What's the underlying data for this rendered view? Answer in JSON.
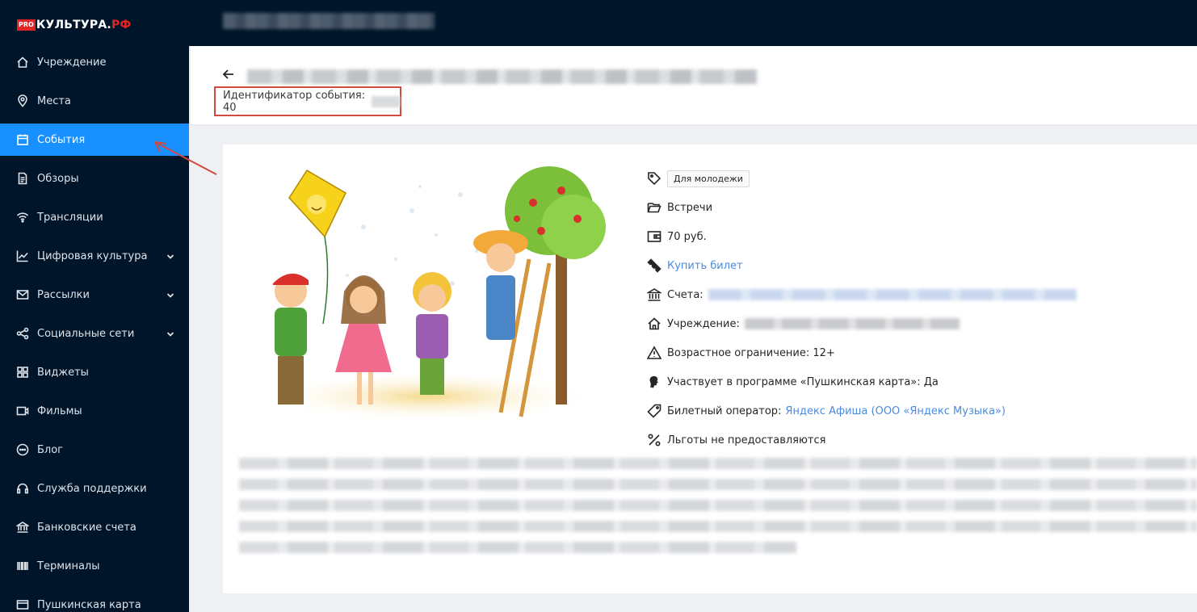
{
  "logo": {
    "pro": "PRO",
    "brand_main": "КУЛЬТУРА.",
    "brand_rf": "РФ"
  },
  "sidebar": {
    "items": [
      {
        "label": "Учреждение",
        "icon": "home-icon"
      },
      {
        "label": "Места",
        "icon": "location-icon"
      },
      {
        "label": "События",
        "icon": "calendar-icon",
        "active": true
      },
      {
        "label": "Обзоры",
        "icon": "document-icon"
      },
      {
        "label": "Трансляции",
        "icon": "wifi-icon"
      },
      {
        "label": "Цифровая культура",
        "icon": "chart-icon",
        "expandable": true
      },
      {
        "label": "Рассылки",
        "icon": "mail-icon",
        "expandable": true
      },
      {
        "label": "Социальные сети",
        "icon": "share-icon",
        "expandable": true
      },
      {
        "label": "Виджеты",
        "icon": "grid-icon"
      },
      {
        "label": "Фильмы",
        "icon": "video-icon"
      },
      {
        "label": "Блог",
        "icon": "chat-icon"
      },
      {
        "label": "Служба поддержки",
        "icon": "headset-icon"
      },
      {
        "label": "Банковские счета",
        "icon": "bank-icon"
      },
      {
        "label": "Терминалы",
        "icon": "barcode-icon"
      },
      {
        "label": "Пушкинская карта",
        "icon": "card-icon"
      }
    ]
  },
  "header": {
    "event_id_label": "Идентификатор события: 40"
  },
  "event": {
    "tag": "Для молодежи",
    "category": "Встречи",
    "price": "70 руб.",
    "buy_ticket": "Купить билет",
    "accounts_label": "Счета:",
    "institution_label": "Учреждение:",
    "age_limit": "Возрастное ограничение: 12+",
    "pushkin_card": "Участвует в программе «Пушкинская карта»: Да",
    "ticket_operator_label": "Билетный оператор:",
    "ticket_operator_value": "Яндекс Афиша (ООО «Яндекс Музыка»)",
    "benefits": "Льготы не предоставляются"
  },
  "colors": {
    "sidebar_bg": "#001529",
    "active_item": "#1890ff",
    "link": "#4a8be0",
    "highlight_border": "#d04a3e",
    "logo_red": "#e12525"
  }
}
